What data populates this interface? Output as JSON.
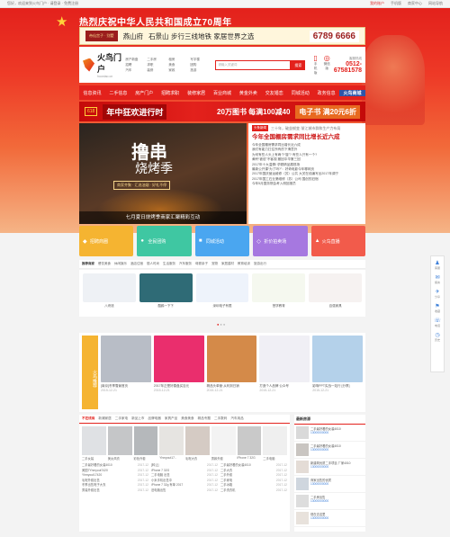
{
  "topbar": {
    "left": "您好，欢迎来到火鸟门户 · 请登录 · 免费注册",
    "links": [
      "我的账户",
      "手机版",
      "商家中心",
      "网站导航"
    ]
  },
  "hero": {
    "slogan": "热烈庆祝中华人民共和国成立70周年"
  },
  "adbanner": {
    "tag": "帝仙宫子 · 别墅",
    "brand": "燕山府",
    "text": "石景山 步行三线地铁 家居世界之选",
    "tel": "6789 6666"
  },
  "header": {
    "logo_name": "火鸟门户",
    "logo_sub": "huoniao.cn",
    "cats": [
      "房产新盘",
      "二手房",
      "租房",
      "写字楼",
      "招聘",
      "求职",
      "美食",
      "团购",
      "汽车",
      "装修",
      "家政",
      "旅游"
    ],
    "search_placeholder": "请输入关键词",
    "search_btn": "搜索",
    "icons": [
      {
        "name": "手机版",
        "glyph": "▯"
      },
      {
        "name": "微信版",
        "glyph": "◎"
      }
    ],
    "hotline_label": "客服热线",
    "hotline": "0512-67581578"
  },
  "nav": [
    "信息资讯",
    "二手信息",
    "房产门户",
    "招聘求职",
    "装修家居",
    "百业商城",
    "黄金外卖",
    "交友婚恋",
    "同城活动",
    "政务信息",
    "火鸟商城"
  ],
  "promo": {
    "a": "618",
    "b": "年中狂欢进行时",
    "c": "20万图书 每满100减40",
    "d": "电子书 满20元6折"
  },
  "slider": {
    "t1": "撸串",
    "t2": "烧烤季",
    "tags": "商家齐聚 · 汇选油烟 · 好礼不停",
    "caption": "七月夏日烧烤季商家汇聚精彩互动"
  },
  "news": {
    "hot": "头条新闻",
    "meta": "三十年，破茧蜕变·渐江城市群和生产力布局",
    "headline": "今年全国棚房需求同比增长近六成",
    "items": [
      "今年全国棚房需求同比增长近六成",
      "我们有能力扛住所有的下滑意外",
      "为何有些人头上有两个“旋”? 有些人只有一个?",
      "黄轩“被怼”不客观 撤回中华第三回",
      "2017年十大温情! 孕婴精品展现场",
      "最新公开课“为了吗?”：好奇电影今年哪网页",
      "2017年国庆营运维修（苏）公共 大关在线编写出2017年调宁",
      "2017年国工石业第维修（苏）公司 国创的旧宿",
      "今年5月国务院会考入侧回报员"
    ]
  },
  "tiles": [
    {
      "label": "招聘商圈",
      "color": "#f5b431",
      "icon": "◆"
    },
    {
      "label": "全民团购",
      "color": "#3fc7a2",
      "icon": "●"
    },
    {
      "label": "同城活动",
      "color": "#4aa6f0",
      "icon": "■"
    },
    {
      "label": "折价拍卖场",
      "color": "#a678e0",
      "icon": "◇"
    },
    {
      "label": "火鸟直播",
      "color": "#f25b4b",
      "icon": "▲"
    }
  ],
  "links": [
    "推荐商家",
    "餐饮美食",
    "休闲娱乐",
    "酒店住宿",
    "丽人时尚",
    "生活服务",
    "汽车服务",
    "母婴亲子",
    "宠物",
    "家居建材",
    "教育培训",
    "旅游出行"
  ],
  "logos": [
    {
      "name": "八块钱",
      "color": "#eef1f5"
    },
    {
      "name": "酷鸥一下下",
      "color": "#2f6b76"
    },
    {
      "name": "深圳电子有限",
      "color": "#eef3fb"
    },
    {
      "name": "慧学教育",
      "color": "#f5f8ef"
    },
    {
      "name": "百强家具",
      "color": "#f6f2f1"
    }
  ],
  "dsec_title": "火鸟推荐",
  "dcards": [
    {
      "t": "[南京]冬季雪景首页",
      "m": "2015-12-21",
      "color": "#b8bdc6"
    },
    {
      "t": "2017年正是好春盘买百元",
      "m": "2015-12-21",
      "color": "#ea2e6d"
    },
    {
      "t": "精品头单营·从利到日销",
      "m": "2015-12-21",
      "color": "#d48a49"
    },
    {
      "t": "打造个人品牌 公众号",
      "m": "2015-12-21",
      "color": "#f0eff5"
    },
    {
      "t": "影响PPT实战一站行 [分享]",
      "m": "2015-12-21",
      "color": "#b4d1ea"
    }
  ],
  "lowtabs": [
    "不在线商",
    "新潮家居",
    "二手家电",
    "新品上市",
    "品牌电器",
    "家具产品",
    "美食美食",
    "精品专题",
    "二手数码",
    "汽车用品"
  ],
  "thumbs": [
    {
      "t": "二手女装",
      "c": "#dfe1e4"
    },
    {
      "t": "美女风衣",
      "c": "#c5c6c8"
    },
    {
      "t": "彩色外套",
      "c": "#b5b8bb"
    },
    {
      "t": "Yhmyout17..",
      "c": "#e6e4e1"
    },
    {
      "t": "毛呢大衣",
      "c": "#d5cbc4"
    },
    {
      "t": "男款外套",
      "c": "#f3f3f3"
    },
    {
      "t": "iPhone 7 32G",
      "c": "#c9c9c9"
    },
    {
      "t": "二手电脑",
      "c": "#efefef"
    }
  ],
  "cols": [
    [
      {
        "a": "二手最好看的女装4010",
        "d": "2017-12"
      },
      {
        "a": "美国7Yhmyout7420",
        "d": "2017-12"
      },
      {
        "a": "Yhmyout17420",
        "d": "2017-12"
      },
      {
        "a": "毛呢外套出售",
        "d": "2017-12"
      },
      {
        "a": "冬季出售呢子大衣",
        "d": "2017-12"
      },
      {
        "a": "男装外套出售",
        "d": "2017-12"
      }
    ],
    [
      {
        "a": "[转让]",
        "d": "2017-12"
      },
      {
        "a": "iPhone 7 32G",
        "d": "2017-12"
      },
      {
        "a": "二手电脑 出售",
        "d": "2017-12"
      },
      {
        "a": "小米手机出售中",
        "d": "2017-12"
      },
      {
        "a": "iPhone 7 32g 有单 2017",
        "d": "2017-12"
      },
      {
        "a": "旧电脑出售",
        "d": "2017-12"
      }
    ],
    [
      {
        "a": "二手最好看的女装4010",
        "d": "2017-12"
      },
      {
        "a": "二手大衣",
        "d": "2017-12"
      },
      {
        "a": "二手外套",
        "d": "2017-12"
      },
      {
        "a": "二手家电",
        "d": "2017-12"
      },
      {
        "a": "二手冰箱",
        "d": "2017-12"
      },
      {
        "a": "二手洗衣机",
        "d": "2017-12"
      }
    ]
  ],
  "right_title": "最新房源",
  "right_items": [
    {
      "t": "二手最好看的女装4010",
      "p": "13000000000"
    },
    {
      "t": "二手最好看的女装4010",
      "p": "13000000000"
    },
    {
      "t": "新建筑优质二手项目 厂家4010",
      "p": "13000000000"
    },
    {
      "t": "商家出售的优质",
      "p": "13000000000"
    },
    {
      "t": "二手房出售",
      "p": "13000000000"
    },
    {
      "t": "现在去这里",
      "p": "13000000000"
    }
  ],
  "rbar": [
    {
      "g": "♟",
      "l": "客服"
    },
    {
      "g": "✉",
      "l": "留言"
    },
    {
      "g": "✈",
      "l": "分享"
    },
    {
      "g": "⚑",
      "l": "收藏"
    },
    {
      "g": "☏",
      "l": "电话"
    },
    {
      "g": "◷",
      "l": "历史"
    }
  ]
}
